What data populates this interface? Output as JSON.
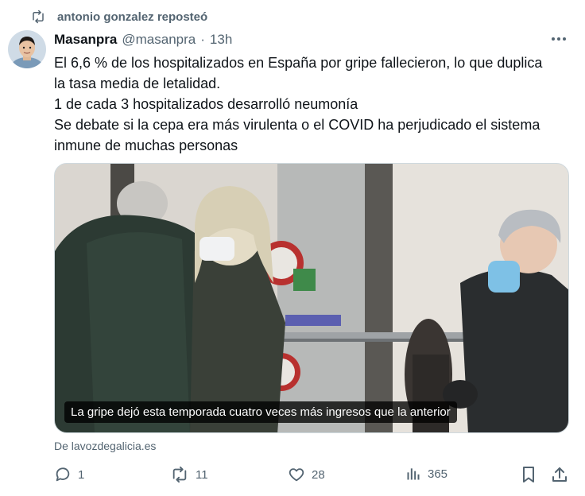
{
  "repost": {
    "label": "antonio gonzalez reposteó",
    "icon": "repost-icon"
  },
  "tweet": {
    "display_name": "Masanpra",
    "handle": "@masanpra",
    "separator": "·",
    "time": "13h",
    "lines": [
      "El 6,6 % de los hospitalizados en España por gripe fallecieron, lo que duplica",
      "la tasa media de letalidad.",
      "1 de cada 3 hospitalizados desarrolló neumonía",
      "Se debate si la cepa era más virulenta o el COVID ha perjudicado el sistema",
      "inmune de muchas personas"
    ],
    "media_caption": "La gripe dejó esta temporada cuatro veces más ingresos que la anterior",
    "source": "De lavozdegalicia.es"
  },
  "actions": {
    "replies": "1",
    "reposts": "11",
    "likes": "28",
    "views": "365"
  },
  "colors": {
    "text": "#0f1419",
    "secondary": "#536471",
    "border": "#cfd9de"
  }
}
